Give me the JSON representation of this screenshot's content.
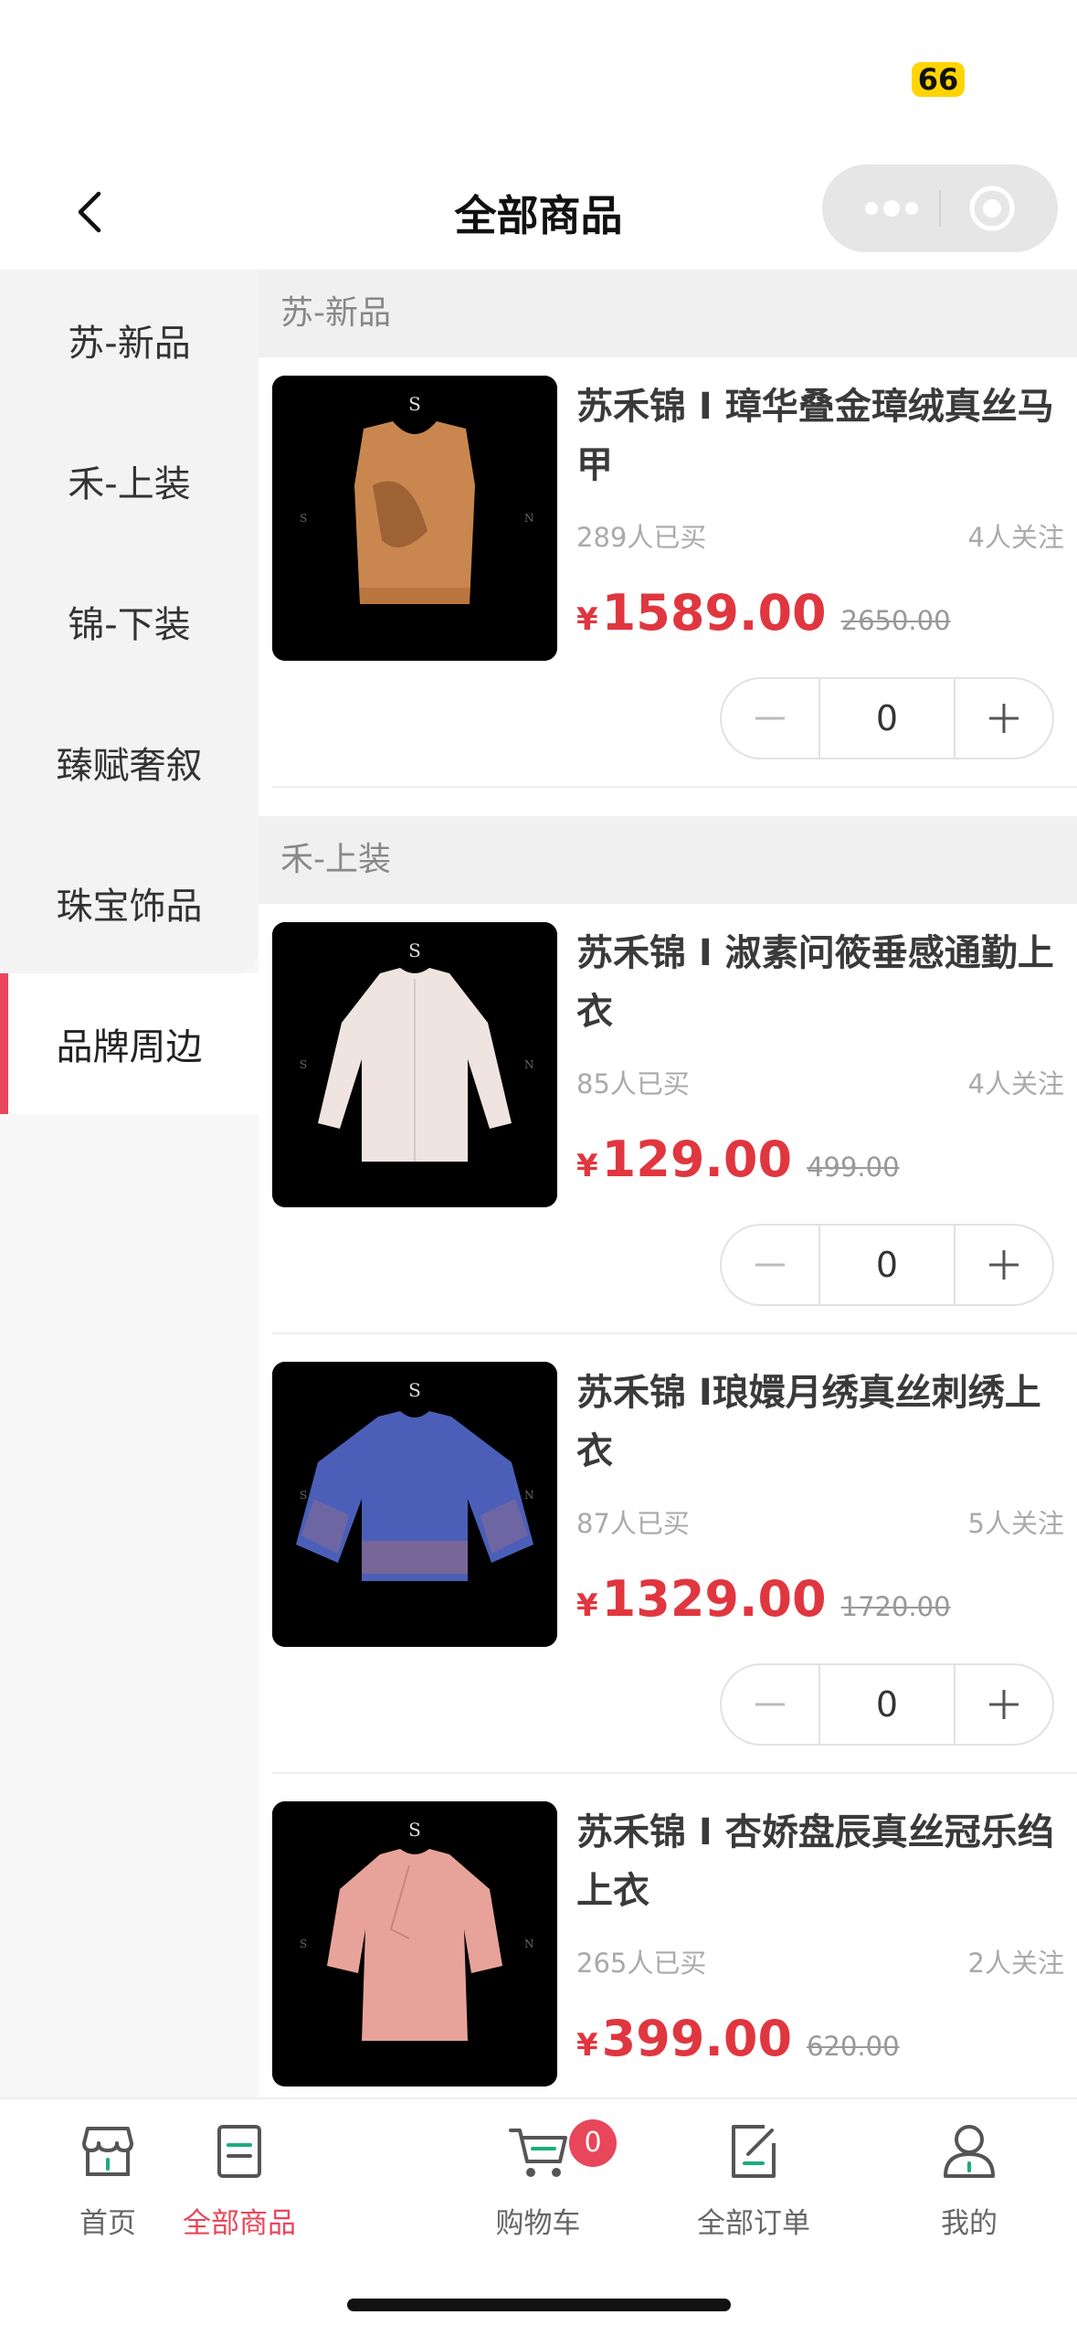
{
  "status": {
    "battery": "66"
  },
  "nav": {
    "title": "全部商品"
  },
  "sidebar": {
    "items": [
      {
        "label": "苏-新品"
      },
      {
        "label": "禾-上装"
      },
      {
        "label": "锦-下装"
      },
      {
        "label": "臻赋奢叙"
      },
      {
        "label": "珠宝饰品"
      },
      {
        "label": "品牌周边"
      }
    ],
    "active_index": 5
  },
  "sections": [
    {
      "title": "苏-新品"
    },
    {
      "title": "禾-上装"
    }
  ],
  "products": [
    {
      "name": "苏禾锦 I 璋华叠金璋绒真丝马甲",
      "sold": "289人已买",
      "follow": "4人关注",
      "currency": "¥",
      "price": "1589.00",
      "original_price": "2650.00",
      "quantity": "0",
      "garment_color": "#c9874f"
    },
    {
      "name": "苏禾锦 I 淑素问筱垂感通勤上衣",
      "sold": "85人已买",
      "follow": "4人关注",
      "currency": "¥",
      "price": "129.00",
      "original_price": "499.00",
      "quantity": "0",
      "garment_color": "#efe4df"
    },
    {
      "name": "苏禾锦 I琅嬛月绣真丝刺绣上衣",
      "sold": "87人已买",
      "follow": "5人关注",
      "currency": "¥",
      "price": "1329.00",
      "original_price": "1720.00",
      "quantity": "0",
      "garment_color": "#4b5fb8"
    },
    {
      "name": "苏禾锦 I 杏娇盘辰真丝冠乐绉上衣",
      "sold": "265人已买",
      "follow": "2人关注",
      "currency": "¥",
      "price": "399.00",
      "original_price": "620.00",
      "quantity": "0",
      "garment_color": "#e7a39a"
    }
  ],
  "tabbar": {
    "items": [
      {
        "label": "首页",
        "icon": "store-icon"
      },
      {
        "label": "全部商品",
        "icon": "list-icon"
      },
      {
        "label": "购物车",
        "icon": "cart-icon"
      },
      {
        "label": "全部订单",
        "icon": "order-icon"
      },
      {
        "label": "我的",
        "icon": "user-icon"
      }
    ],
    "cart_count": "0",
    "active_index": 1
  },
  "colors": {
    "accent": "#e8465a",
    "price": "#e0363f"
  }
}
